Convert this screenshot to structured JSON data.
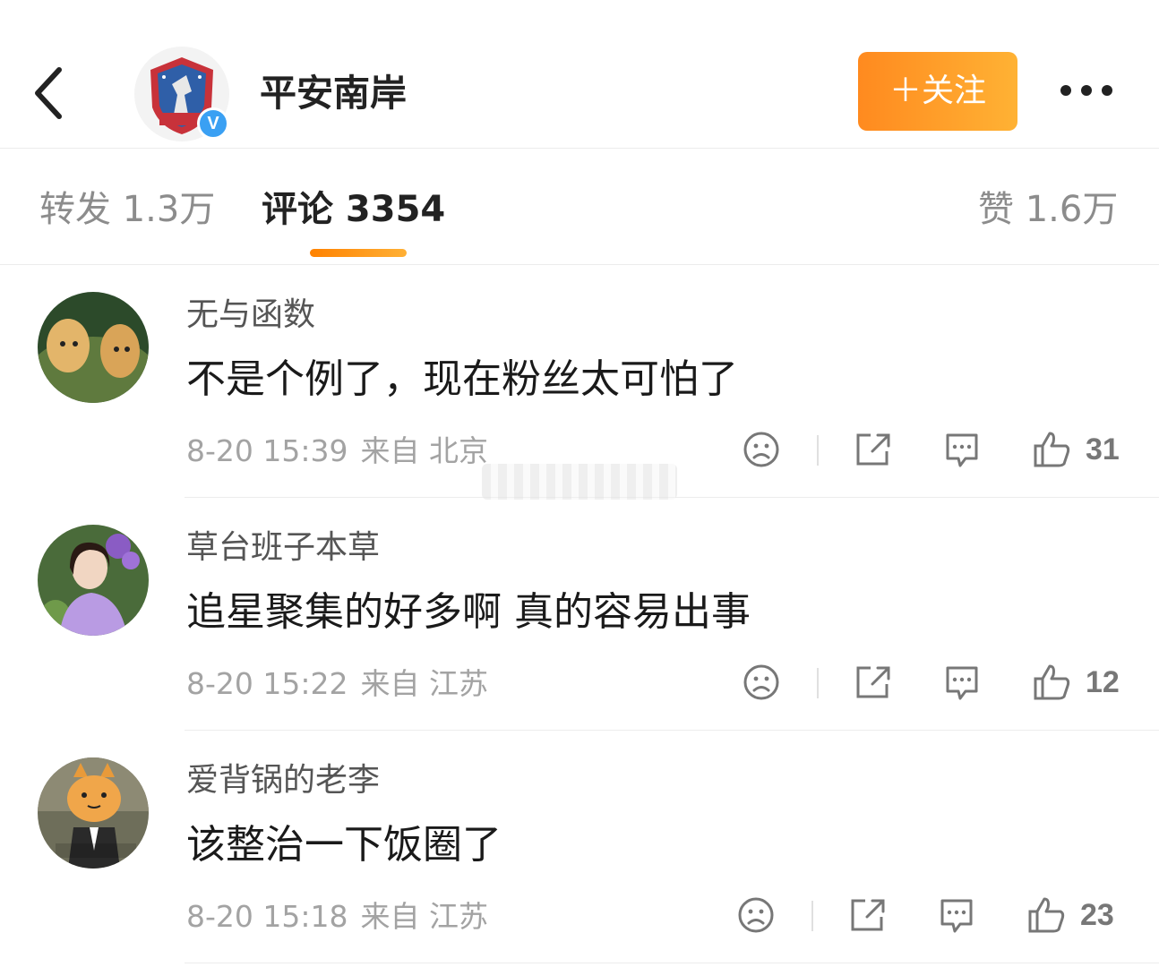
{
  "header": {
    "account_name": "平安南岸",
    "verified_mark": "V",
    "follow_label": "＋关注",
    "brand_color": "#ff8a1f"
  },
  "tabs": [
    {
      "label": "转发 1.3万",
      "active": false
    },
    {
      "label": "评论 3354",
      "active": true
    },
    {
      "label": "赞 1.6万",
      "active": false
    }
  ],
  "comments": [
    {
      "user": "无与函数",
      "text": "不是个例了，现在粉丝太可怕了",
      "time": "8-20 15:39",
      "location": "来自 北京",
      "likes": "31",
      "avatar": "golden-retriever-puppies"
    },
    {
      "user": "草台班子本草",
      "text": "追星聚集的好多啊 真的容易出事",
      "time": "8-20 15:22",
      "location": "来自 江苏",
      "likes": "12",
      "avatar": "girl-with-purple-flowers"
    },
    {
      "user": "爱背锅的老李",
      "text": "该整治一下饭圈了",
      "time": "8-20 15:18",
      "location": "来自 江苏",
      "likes": "23",
      "avatar": "cartoon-cat-in-suit"
    }
  ],
  "icons": {
    "back": "chevron-left-icon",
    "more": "more-dots-icon",
    "dislike": "sad-face-icon",
    "repost": "share-icon",
    "reply": "comment-icon",
    "like": "thumbs-up-icon"
  }
}
